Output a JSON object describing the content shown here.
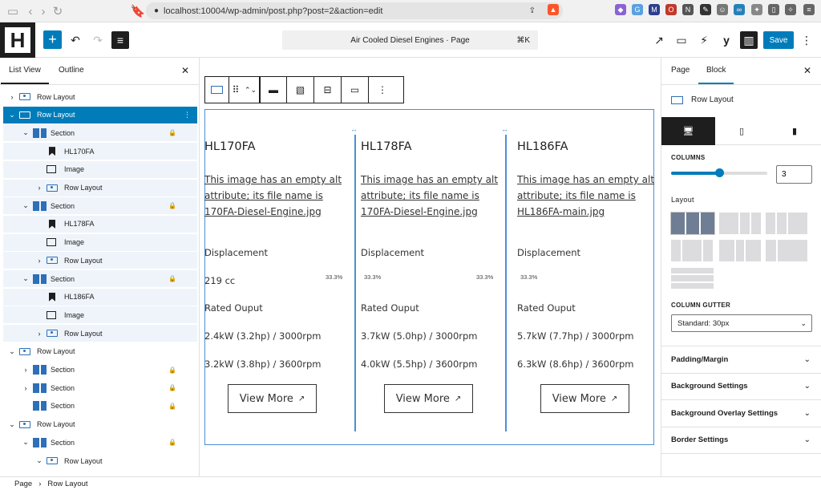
{
  "browser": {
    "url_host": "localhost",
    "url_path": ":10004/wp-admin/post.php?post=2&action=edit"
  },
  "toolbar": {
    "document_title": "Air Cooled Diesel Engines · Page",
    "shortcut": "⌘K",
    "save_label": "Save"
  },
  "left_panel": {
    "tabs": [
      "List View",
      "Outline"
    ],
    "items": [
      {
        "label": "Row Layout",
        "depth": 0,
        "icon": "row",
        "chevron": "right"
      },
      {
        "label": "Row Layout",
        "depth": 0,
        "icon": "row",
        "chevron": "down",
        "selected": true
      },
      {
        "label": "Section",
        "depth": 1,
        "icon": "section",
        "chevron": "down",
        "locked": true
      },
      {
        "label": "HL170FA",
        "depth": 2,
        "icon": "bookmark"
      },
      {
        "label": "Image",
        "depth": 2,
        "icon": "image"
      },
      {
        "label": "Row Layout",
        "depth": 2,
        "icon": "row",
        "chevron": "right"
      },
      {
        "label": "Section",
        "depth": 1,
        "icon": "section",
        "chevron": "down",
        "locked": true
      },
      {
        "label": "HL178FA",
        "depth": 2,
        "icon": "bookmark"
      },
      {
        "label": "Image",
        "depth": 2,
        "icon": "image"
      },
      {
        "label": "Row Layout",
        "depth": 2,
        "icon": "row",
        "chevron": "right"
      },
      {
        "label": "Section",
        "depth": 1,
        "icon": "section",
        "chevron": "down",
        "locked": true
      },
      {
        "label": "HL186FA",
        "depth": 2,
        "icon": "bookmark"
      },
      {
        "label": "Image",
        "depth": 2,
        "icon": "image"
      },
      {
        "label": "Row Layout",
        "depth": 2,
        "icon": "row",
        "chevron": "right"
      },
      {
        "label": "Row Layout",
        "depth": 0,
        "icon": "row",
        "chevron": "down"
      },
      {
        "label": "Section",
        "depth": 1,
        "icon": "section",
        "chevron": "right",
        "locked": true
      },
      {
        "label": "Section",
        "depth": 1,
        "icon": "section",
        "chevron": "right",
        "locked": true
      },
      {
        "label": "Section",
        "depth": 1,
        "icon": "section",
        "locked": true
      },
      {
        "label": "Row Layout",
        "depth": 0,
        "icon": "row",
        "chevron": "down"
      },
      {
        "label": "Section",
        "depth": 1,
        "icon": "section",
        "chevron": "down",
        "locked": true
      },
      {
        "label": "Row Layout",
        "depth": 2,
        "icon": "row",
        "chevron": "down"
      }
    ]
  },
  "canvas": {
    "columns": [
      {
        "title": "HL170FA",
        "alt_text": "This image has an empty alt attribute; its file name is 170FA-Diesel-Engine.jpg",
        "displacement_label": "Displacement",
        "displacement_value": "219 cc",
        "rated_label": "Rated Ouput",
        "rating_1": "2.4kW (3.2hp) / 3000rpm",
        "rating_2": "3.2kW (3.8hp) / 3600rpm",
        "button": "View More"
      },
      {
        "title": "HL178FA",
        "alt_text": "This image has an empty alt attribute; its file name is 170FA-Diesel-Engine.jpg",
        "displacement_label": "Displacement",
        "displacement_value": "33.3%",
        "rated_label": "Rated Ouput",
        "rating_1": "3.7kW (5.0hp) / 3000rpm",
        "rating_2": "4.0kW (5.5hp) / 3600rpm",
        "button": "View More"
      },
      {
        "title": "HL186FA",
        "alt_text": "This image has an empty alt attribute; its file name is HL186FA-main.jpg",
        "displacement_label": "Displacement",
        "displacement_value": "33.3%",
        "rated_label": "Rated Ouput",
        "rating_1": "5.7kW (7.7hp) / 3000rpm",
        "rating_2": "6.3kW (8.6hp) / 3600rpm",
        "button": "View More"
      }
    ],
    "col_widths": [
      "33.3%",
      "33.3%"
    ]
  },
  "right_panel": {
    "tabs": [
      "Page",
      "Block"
    ],
    "block_name": "Row Layout",
    "columns_label": "COLUMNS",
    "columns_value": "3",
    "columns_level": 0.5,
    "layout_label": "Layout",
    "gutter_label": "COLUMN GUTTER",
    "gutter_value": "Standard: 30px",
    "sections": [
      "Padding/Margin",
      "Background Settings",
      "Background Overlay Settings",
      "Border Settings"
    ]
  },
  "footer": {
    "crumbs": [
      "Page",
      "Row Layout"
    ]
  },
  "colors": {
    "accent": "#007cba",
    "selection": "#007cba",
    "outline": "#4a8fd6"
  }
}
